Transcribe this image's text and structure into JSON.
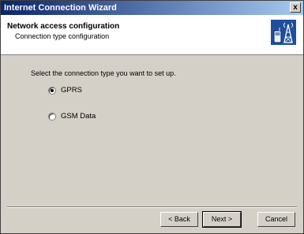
{
  "window": {
    "title": "Internet Connection Wizard",
    "close_glyph": "x"
  },
  "header": {
    "title": "Network access configuration",
    "subtitle": "Connection type configuration",
    "icon": "phone-antenna-icon"
  },
  "body": {
    "prompt": "Select the connection type you want to set up.",
    "options": [
      {
        "label": "GPRS",
        "selected": true
      },
      {
        "label": "GSM Data",
        "selected": false
      }
    ]
  },
  "buttons": {
    "back": "< Back",
    "next": "Next >",
    "cancel": "Cancel"
  },
  "colors": {
    "titlebar_start": "#0a246a",
    "titlebar_end": "#a6caf0",
    "dialog_bg": "#d4d0c8"
  }
}
